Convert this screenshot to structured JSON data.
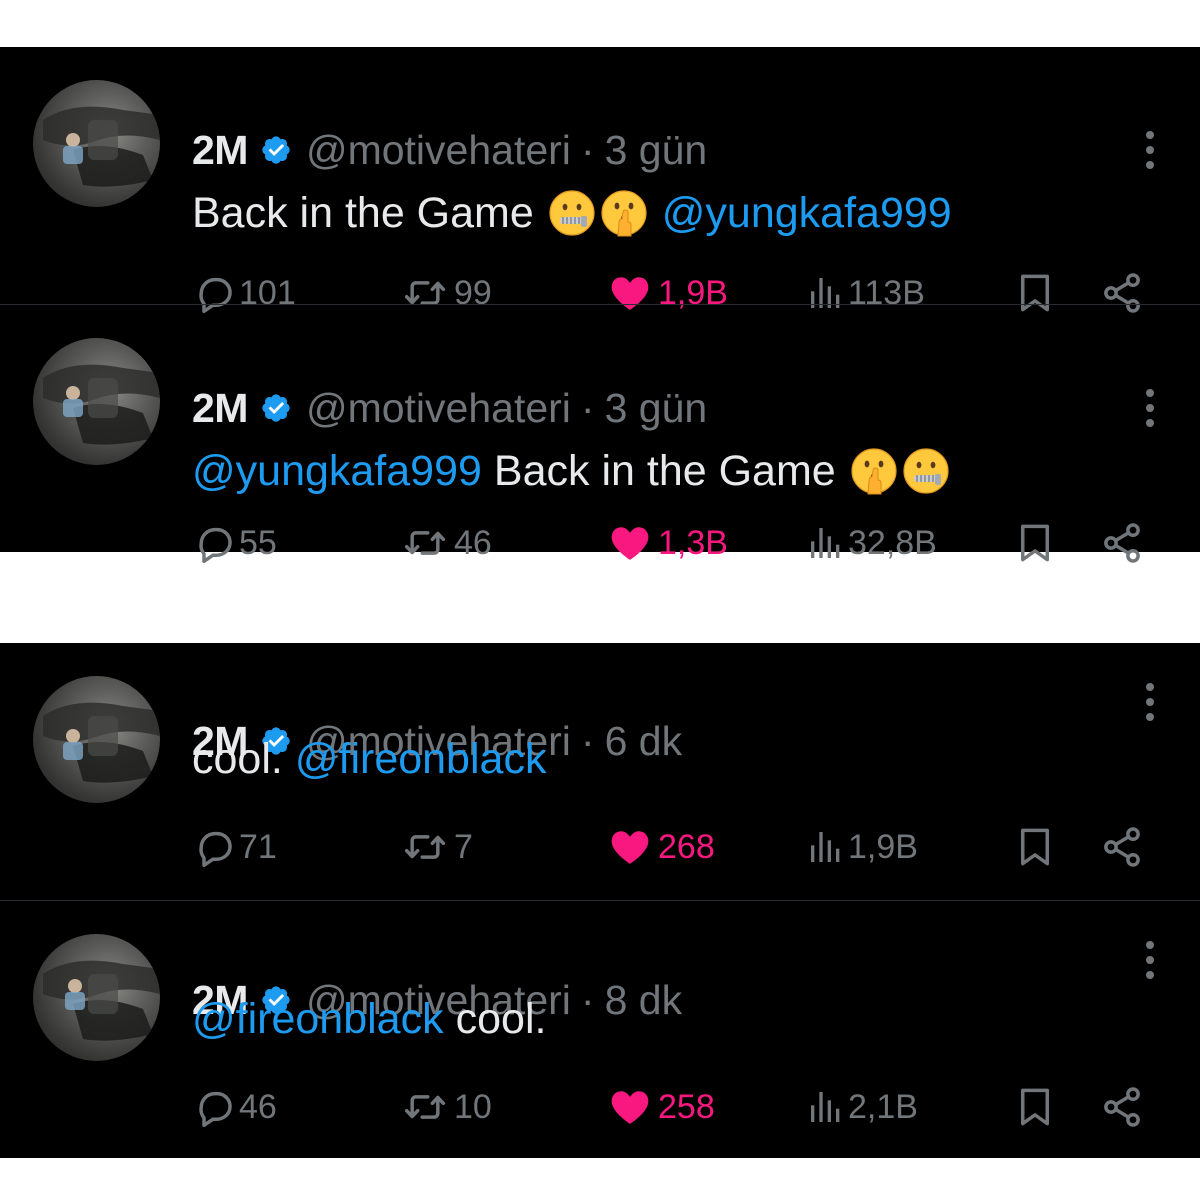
{
  "colors": {
    "background": "#000000",
    "text": "#e7e9ea",
    "muted": "#71767b",
    "mention": "#1d9bf0",
    "like": "#f91880",
    "verified": "#1d9bf0"
  },
  "tweets": [
    {
      "name": "2M",
      "handle": "@motivehateri",
      "separator": "·",
      "time": "3 gün",
      "text": {
        "before": "Back in the Game",
        "emoji": [
          "zipper-mouth-face",
          "shushing-face"
        ],
        "mention": "@yungkafa999"
      },
      "replies": "101",
      "retweets": "99",
      "likes": "1,9B",
      "views": "113B"
    },
    {
      "name": "2M",
      "handle": "@motivehateri",
      "separator": "·",
      "time": "3 gün",
      "text": {
        "mention": "@yungkafa999",
        "after": "Back in the Game",
        "emoji": [
          "shushing-face",
          "zipper-mouth-face"
        ]
      },
      "replies": "55",
      "retweets": "46",
      "likes": "1,3B",
      "views": "32,8B"
    },
    {
      "name": "2M",
      "handle": "@motivehateri",
      "separator": "·",
      "time": "6 dk",
      "text": {
        "before": "cool.",
        "mention": "@fireonblack"
      },
      "replies": "71",
      "retweets": "7",
      "likes": "268",
      "views": "1,9B"
    },
    {
      "name": "2M",
      "handle": "@motivehateri",
      "separator": "·",
      "time": "8 dk",
      "text": {
        "mention": "@fireonblack",
        "after": "cool."
      },
      "replies": "46",
      "retweets": "10",
      "likes": "258",
      "views": "2,1B"
    }
  ],
  "icons": {
    "reply": "reply-bubble-icon",
    "retweet": "retweet-icon",
    "like": "heart-filled-icon",
    "views": "views-bar-chart-icon",
    "bookmark": "bookmark-icon",
    "share": "share-icon",
    "more": "more-vertical-icon",
    "verified": "verified-badge-icon"
  }
}
